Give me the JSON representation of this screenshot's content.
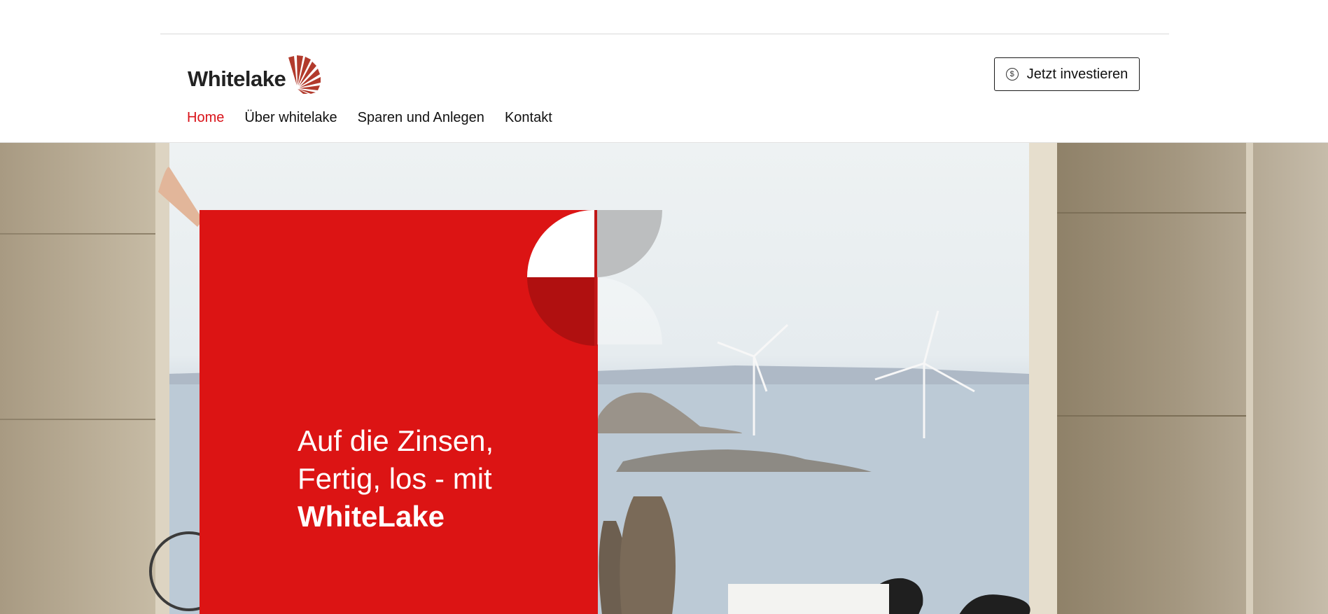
{
  "brand": {
    "name": "Whitelake",
    "logo_icon": "sunburst-logo-icon",
    "logo_color": "#b23a2c"
  },
  "header": {
    "cta_label": "Jetzt investieren",
    "cta_icon": "dollar-circle-icon",
    "cta_icon_glyph": "$"
  },
  "nav": {
    "items": [
      {
        "label": "Home",
        "active": true
      },
      {
        "label": "Über whitelake",
        "active": false
      },
      {
        "label": "Sparen und Anlegen",
        "active": false
      },
      {
        "label": "Kontakt",
        "active": false
      }
    ],
    "active_color": "#d9131a"
  },
  "hero": {
    "headline_line1": "Auf die Zinsen,",
    "headline_line2": "Fertig, los - mit",
    "headline_brand": "WhiteLake",
    "card_color": "#dc1414"
  }
}
